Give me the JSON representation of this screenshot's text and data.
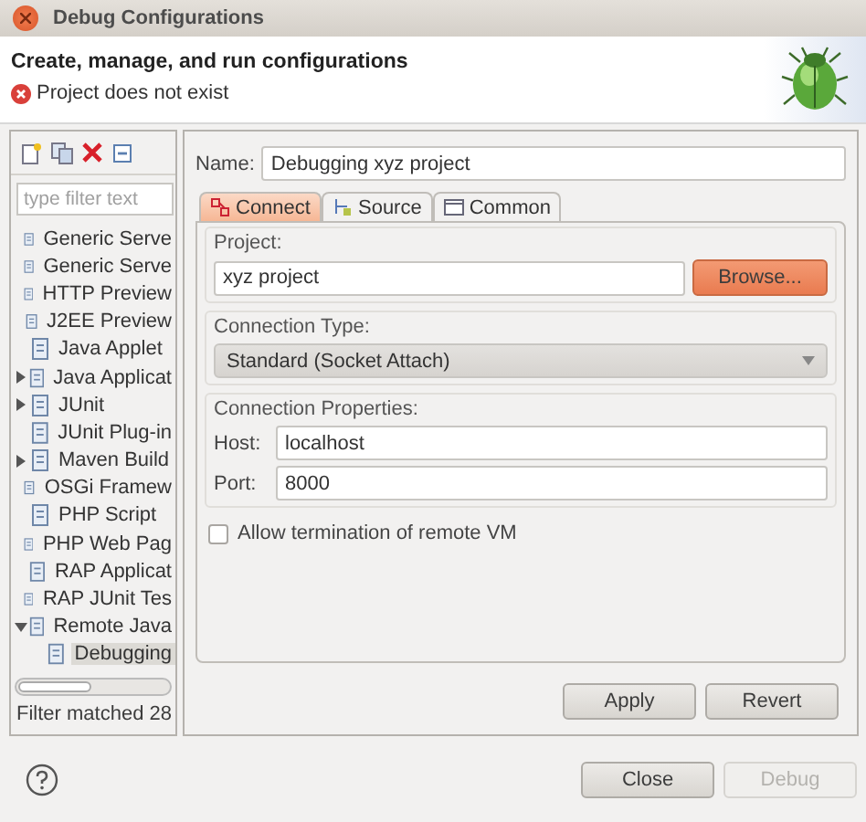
{
  "window": {
    "title": "Debug Configurations"
  },
  "header": {
    "title": "Create, manage, and run configurations",
    "message": "Project does not exist"
  },
  "sidebar": {
    "filter": {
      "placeholder": "type filter text"
    },
    "tree": [
      {
        "label": "Generic Serve",
        "kind": "item",
        "selected": false
      },
      {
        "label": "Generic Serve",
        "kind": "item",
        "selected": false
      },
      {
        "label": "HTTP Preview",
        "kind": "item",
        "selected": false
      },
      {
        "label": "J2EE Preview",
        "kind": "item",
        "selected": false
      },
      {
        "label": "Java Applet",
        "kind": "item",
        "selected": false
      },
      {
        "label": "Java Applicat",
        "kind": "group",
        "expanded": false,
        "selected": false
      },
      {
        "label": "JUnit",
        "kind": "group",
        "expanded": false,
        "selected": false
      },
      {
        "label": "JUnit Plug-in",
        "kind": "item",
        "selected": false
      },
      {
        "label": "Maven Build",
        "kind": "group",
        "expanded": false,
        "selected": false
      },
      {
        "label": "OSGi Framew",
        "kind": "item",
        "selected": false
      },
      {
        "label": "PHP Script",
        "kind": "item",
        "selected": false
      },
      {
        "label": "PHP Web Pag",
        "kind": "item",
        "selected": false
      },
      {
        "label": "RAP Applicat",
        "kind": "item",
        "selected": false
      },
      {
        "label": "RAP JUnit Tes",
        "kind": "item",
        "selected": false
      },
      {
        "label": "Remote Java",
        "kind": "group",
        "expanded": true,
        "selected": false,
        "children": [
          {
            "label": "Debugging",
            "kind": "item",
            "selected": true
          }
        ]
      }
    ],
    "status": "Filter matched 28"
  },
  "form": {
    "name_label": "Name:",
    "name": "Debugging xyz project",
    "tabs": [
      {
        "label": "Connect",
        "selected": true
      },
      {
        "label": "Source",
        "selected": false
      },
      {
        "label": "Common",
        "selected": false
      }
    ],
    "project": {
      "label": "Project:",
      "value": "xyz project",
      "button": "Browse..."
    },
    "connection_type": {
      "label": "Connection Type:",
      "value": "Standard (Socket Attach)"
    },
    "connection_properties": {
      "label": "Connection Properties:",
      "fields": [
        {
          "label": "Host:",
          "value": "localhost"
        },
        {
          "label": "Port:",
          "value": "8000"
        }
      ]
    },
    "allow_termination": {
      "label": "Allow termination of remote VM",
      "checked": false
    },
    "buttons": [
      {
        "label": "Apply",
        "disabled": false
      },
      {
        "label": "Revert",
        "disabled": false
      }
    ]
  },
  "footer": {
    "buttons": [
      {
        "label": "Close",
        "disabled": false
      },
      {
        "label": "Debug",
        "disabled": true
      }
    ]
  }
}
